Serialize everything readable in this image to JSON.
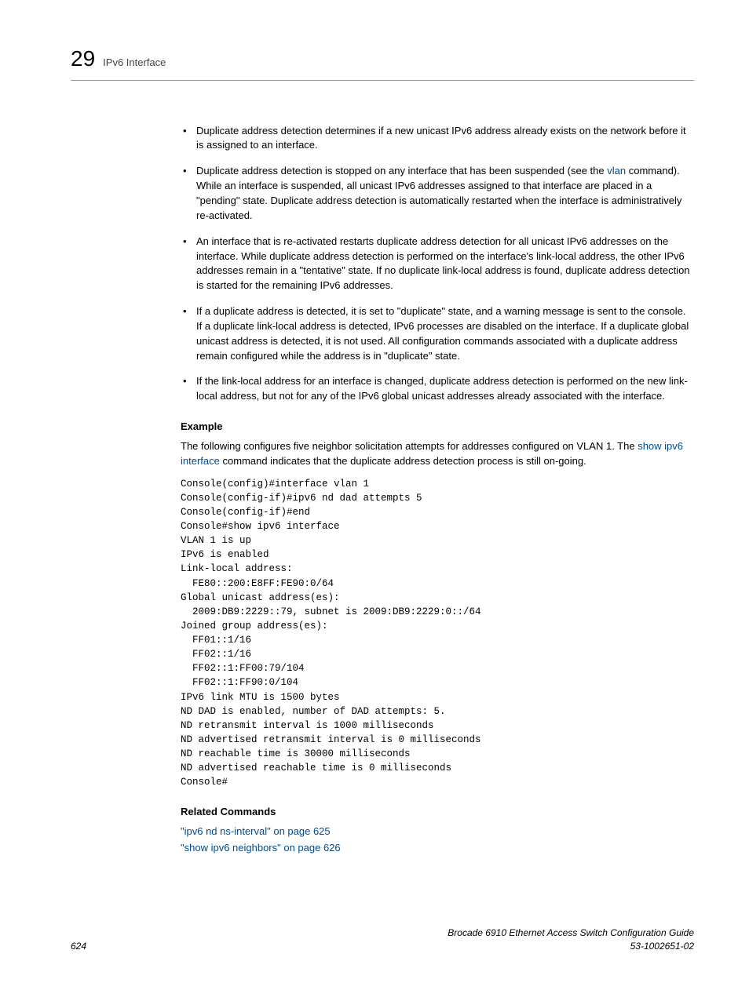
{
  "header": {
    "chapter": "29",
    "section": "IPv6 Interface"
  },
  "bullets": [
    {
      "pre": "Duplicate address detection determines if a new unicast IPv6 address already exists on the network before it is assigned to an interface."
    },
    {
      "pre": "Duplicate address detection is stopped on any interface that has been suspended (see the ",
      "link": "vlan",
      "post": " command). While an interface is suspended, all unicast IPv6 addresses assigned to that interface are placed in a \"pending\" state. Duplicate address detection is automatically restarted when the interface is administratively re-activated."
    },
    {
      "pre": "An interface that is re-activated restarts duplicate address detection for all unicast IPv6 addresses on the interface. While duplicate address detection is performed on the interface's link-local address, the other IPv6 addresses remain in a \"tentative\" state. If no duplicate link-local address is found, duplicate address detection is started for the remaining IPv6 addresses."
    },
    {
      "pre": "If a duplicate address is detected, it is set to \"duplicate\" state, and a warning message is sent to the console. If a duplicate link-local address is detected, IPv6 processes are disabled on the interface. If a duplicate global unicast address is detected, it is not used. All configuration commands associated with a duplicate address remain configured while the address is in \"duplicate\" state."
    },
    {
      "pre": "If the link-local address for an interface is changed, duplicate address detection is performed on the new link-local address, but not for any of the IPv6 global unicast addresses already associated with the interface."
    }
  ],
  "example": {
    "heading": "Example",
    "intro_pre": "The following configures five neighbor solicitation attempts for addresses configured on VLAN 1. The ",
    "intro_link": "show ipv6 interface",
    "intro_post": " command indicates that the duplicate address detection process is still on-going.",
    "code": "Console(config)#interface vlan 1\nConsole(config-if)#ipv6 nd dad attempts 5\nConsole(config-if)#end\nConsole#show ipv6 interface\nVLAN 1 is up\nIPv6 is enabled\nLink-local address:\n  FE80::200:E8FF:FE90:0/64\nGlobal unicast address(es):\n  2009:DB9:2229::79, subnet is 2009:DB9:2229:0::/64\nJoined group address(es):\n  FF01::1/16\n  FF02::1/16\n  FF02::1:FF00:79/104\n  FF02::1:FF90:0/104\nIPv6 link MTU is 1500 bytes\nND DAD is enabled, number of DAD attempts: 5.\nND retransmit interval is 1000 milliseconds\nND advertised retransmit interval is 0 milliseconds\nND reachable time is 30000 milliseconds\nND advertised reachable time is 0 milliseconds\nConsole#"
  },
  "related": {
    "heading": "Related Commands",
    "links": [
      "\"ipv6 nd ns-interval\" on page 625",
      "\"show ipv6 neighbors\" on page 626"
    ]
  },
  "footer": {
    "page": "624",
    "title": "Brocade 6910 Ethernet Access Switch Configuration Guide",
    "docnum": "53-1002651-02"
  }
}
